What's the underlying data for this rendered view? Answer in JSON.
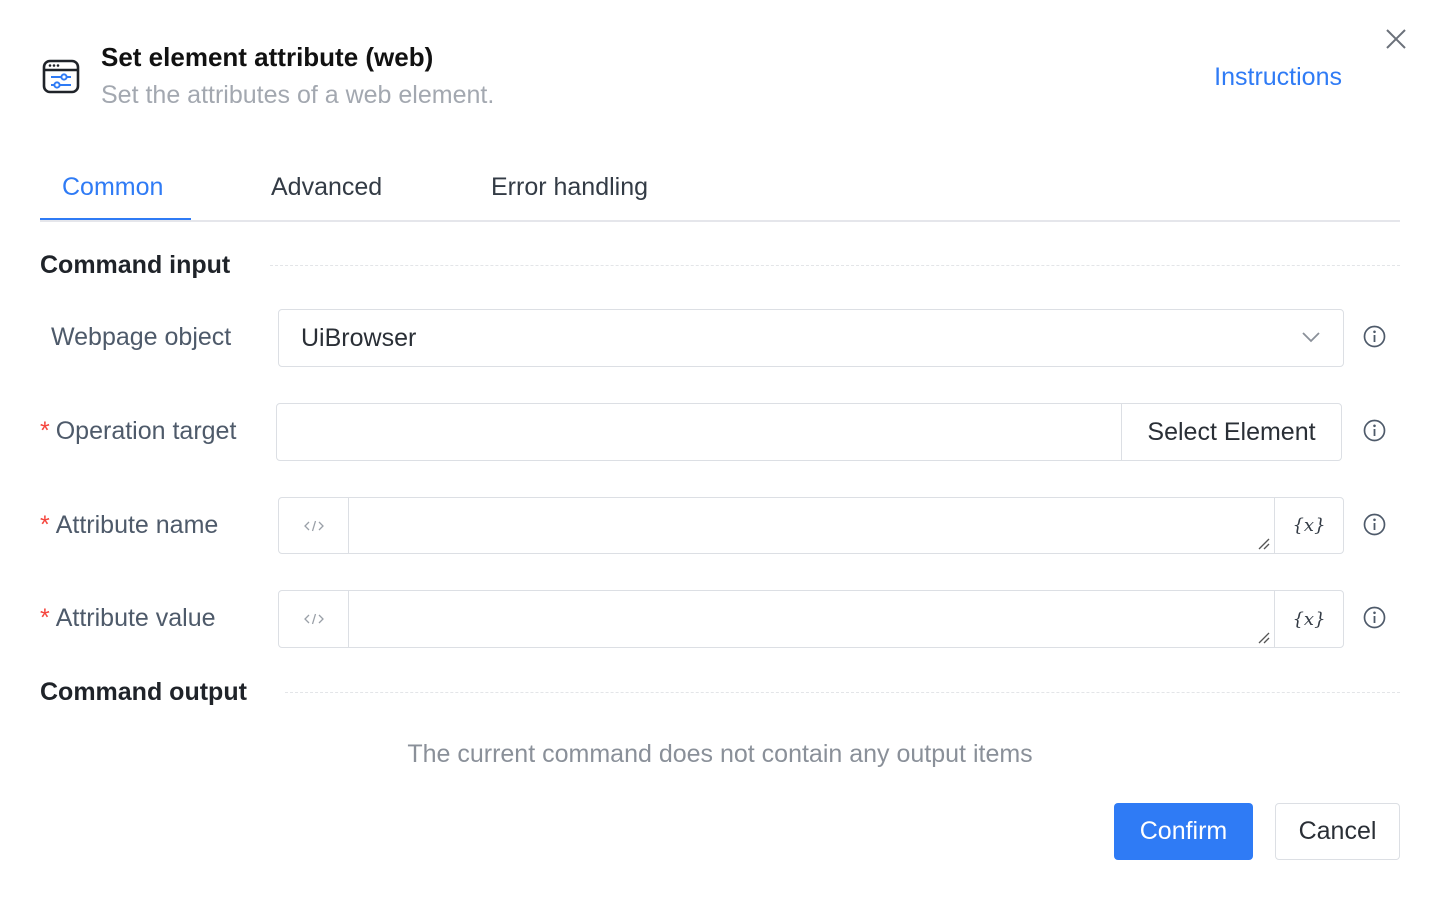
{
  "header": {
    "title": "Set element attribute (web)",
    "subtitle": "Set the attributes of a web element.",
    "instructions_link": "Instructions",
    "icon": "browser-settings-icon"
  },
  "tabs": [
    {
      "label": "Common",
      "active": true
    },
    {
      "label": "Advanced",
      "active": false
    },
    {
      "label": "Error handling",
      "active": false
    }
  ],
  "sections": {
    "input_title": "Command input",
    "output_title": "Command output",
    "output_empty": "The current command does not contain any output items"
  },
  "fields": {
    "webpage_object": {
      "label": "Webpage object",
      "value": "UiBrowser"
    },
    "operation_target": {
      "label": "Operation target",
      "required_mark": "*",
      "value": "",
      "button": "Select Element"
    },
    "attribute_name": {
      "label": "Attribute name",
      "required_mark": "*",
      "value": "",
      "variable_button": "{x}"
    },
    "attribute_value": {
      "label": "Attribute value",
      "required_mark": "*",
      "value": "",
      "variable_button": "{x}"
    }
  },
  "footer": {
    "confirm": "Confirm",
    "cancel": "Cancel"
  },
  "colors": {
    "accent": "#2f7bf5",
    "required": "#f5453d"
  }
}
